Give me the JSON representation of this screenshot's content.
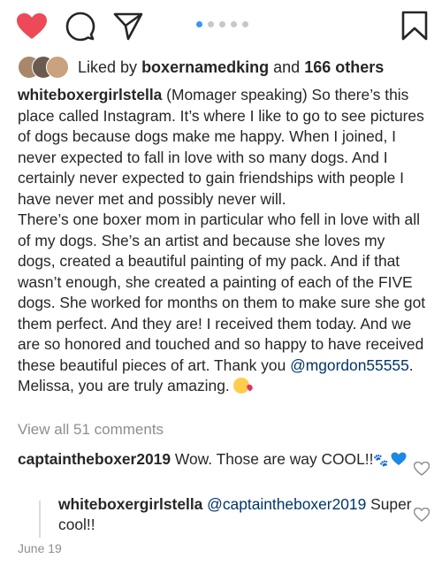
{
  "likes": {
    "prefix": "Liked by",
    "user": "boxernamedking",
    "conjunction": "and",
    "others": "166 others"
  },
  "caption": {
    "username": "whiteboxergirlstella",
    "para1": "(Momager speaking) So there’s this place called Instagram. It’s where I like to go to see pictures of dogs because dogs make me happy. When I joined, I never expected to fall in love with so many dogs. And I certainly never expected to gain friendships with people I have never met and possibly never will.",
    "para2": "There’s one boxer mom in particular who fell in love with all of my dogs. She’s an artist and because she loves my dogs, created a beautiful painting of my pack. And if that wasn’t enough, she created a painting of each of the FIVE dogs. She worked for months on them to make sure she got them perfect. And they are! I received them today. And we are so honored and touched and so happy to have received these beautiful pieces of art. Thank you",
    "mention": "@mgordon55555",
    "para2_end": ". Melissa, you are truly amazing."
  },
  "view_all": "View all 51 comments",
  "comments": [
    {
      "username": "captaintheboxer2019",
      "text": "Wow. Those are way COOL!!"
    },
    {
      "username": "whiteboxergirlstella",
      "mention": "@captaintheboxer2019",
      "text": "Super cool!!"
    }
  ],
  "date": "June 19",
  "colors": {
    "like": "#ed4956",
    "link": "#003569",
    "muted": "#8e8e8e",
    "active_dot": "#3897f0"
  },
  "icons": [
    "heart-filled-icon",
    "comment-icon",
    "share-icon",
    "bookmark-icon",
    "heart-outline-icon",
    "paw-icon",
    "blue-heart-icon",
    "kissing-face-emoji"
  ]
}
